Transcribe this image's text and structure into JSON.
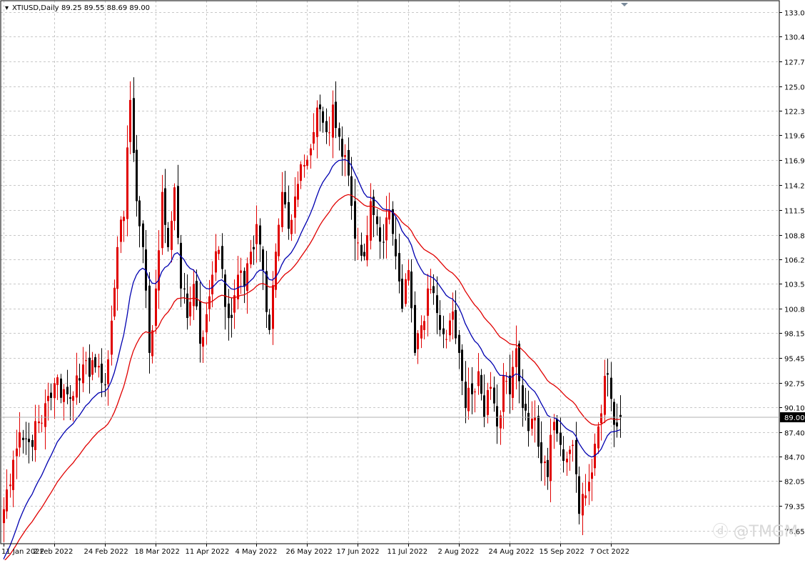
{
  "header": {
    "symbol": "XTIUSD,Daily",
    "ohlc": "89.25 89.55 88.69 89.00"
  },
  "watermark": "@TMGM",
  "chart_data": {
    "type": "candlestick",
    "symbol": "XTIUSD",
    "timeframe": "Daily",
    "ylim": [
      76.0,
      133.5
    ],
    "y_ticks": [
      "133.05",
      "130.40",
      "127.70",
      "125.00",
      "122.35",
      "119.65",
      "116.95",
      "114.25",
      "111.55",
      "108.85",
      "106.20",
      "103.50",
      "100.80",
      "98.15",
      "95.45",
      "92.75",
      "90.10",
      "87.40",
      "84.70",
      "82.05",
      "79.35",
      "76.65"
    ],
    "x_ticks": [
      {
        "label": "11 Jan 2022",
        "bar": 0
      },
      {
        "label": "2 Feb 2022",
        "bar": 16
      },
      {
        "label": "24 Feb 2022",
        "bar": 32
      },
      {
        "label": "18 Mar 2022",
        "bar": 48
      },
      {
        "label": "11 Apr 2022",
        "bar": 64
      },
      {
        "label": "4 May 2022",
        "bar": 80
      },
      {
        "label": "26 May 2022",
        "bar": 96
      },
      {
        "label": "17 Jun 2022",
        "bar": 112
      },
      {
        "label": "11 Jul 2022",
        "bar": 128
      },
      {
        "label": "2 Aug 2022",
        "bar": 144
      },
      {
        "label": "24 Aug 2022",
        "bar": 160
      },
      {
        "label": "15 Sep 2022",
        "bar": 176
      },
      {
        "label": "7 Oct 2022",
        "bar": 192
      }
    ],
    "current_price": "89.00",
    "colors": {
      "bull": "#e00000",
      "bear": "#000000",
      "ma_fast": "#0000b0",
      "ma_slow": "#e00000",
      "grid": "#c8c8c8",
      "price_tag_bg": "#000000",
      "price_tag_fg": "#ffffff"
    },
    "grid": true,
    "ma_fast_period": 20,
    "ma_slow_period": 40,
    "close_anchors": [
      [
        0,
        79.0
      ],
      [
        4,
        85.6
      ],
      [
        8,
        86.3
      ],
      [
        12,
        88.4
      ],
      [
        16,
        92.7
      ],
      [
        20,
        91.5
      ],
      [
        24,
        93.0
      ],
      [
        28,
        95.2
      ],
      [
        32,
        92.5
      ],
      [
        34,
        99.5
      ],
      [
        36,
        107.5
      ],
      [
        38,
        110.8
      ],
      [
        40,
        123.5
      ],
      [
        42,
        112.5
      ],
      [
        44,
        107.5
      ],
      [
        46,
        96.0
      ],
      [
        48,
        103.0
      ],
      [
        50,
        113.5
      ],
      [
        52,
        107.5
      ],
      [
        54,
        114.0
      ],
      [
        56,
        103.0
      ],
      [
        58,
        99.8
      ],
      [
        60,
        103.5
      ],
      [
        62,
        97.0
      ],
      [
        64,
        100.2
      ],
      [
        66,
        104.5
      ],
      [
        68,
        107.2
      ],
      [
        70,
        101.0
      ],
      [
        72,
        99.8
      ],
      [
        74,
        104.5
      ],
      [
        76,
        103.2
      ],
      [
        78,
        107.0
      ],
      [
        80,
        110.0
      ],
      [
        82,
        105.0
      ],
      [
        84,
        98.5
      ],
      [
        86,
        107.0
      ],
      [
        88,
        113.5
      ],
      [
        90,
        109.5
      ],
      [
        92,
        113.0
      ],
      [
        94,
        116.5
      ],
      [
        96,
        117.0
      ],
      [
        98,
        120.0
      ],
      [
        100,
        122.5
      ],
      [
        102,
        120.0
      ],
      [
        104,
        123.0
      ],
      [
        106,
        119.5
      ],
      [
        108,
        117.5
      ],
      [
        110,
        112.0
      ],
      [
        112,
        108.0
      ],
      [
        114,
        106.5
      ],
      [
        116,
        112.5
      ],
      [
        118,
        110.0
      ],
      [
        120,
        108.0
      ],
      [
        122,
        111.5
      ],
      [
        124,
        106.5
      ],
      [
        126,
        100.8
      ],
      [
        128,
        105.0
      ],
      [
        130,
        96.0
      ],
      [
        132,
        99.0
      ],
      [
        134,
        103.0
      ],
      [
        136,
        102.5
      ],
      [
        138,
        98.5
      ],
      [
        140,
        97.5
      ],
      [
        142,
        100.5
      ],
      [
        144,
        96.0
      ],
      [
        146,
        90.0
      ],
      [
        148,
        91.5
      ],
      [
        150,
        94.0
      ],
      [
        152,
        89.0
      ],
      [
        154,
        92.3
      ],
      [
        156,
        88.0
      ],
      [
        158,
        93.5
      ],
      [
        160,
        91.5
      ],
      [
        162,
        96.5
      ],
      [
        164,
        90.0
      ],
      [
        166,
        87.5
      ],
      [
        168,
        89.0
      ],
      [
        170,
        84.0
      ],
      [
        172,
        82.5
      ],
      [
        174,
        88.5
      ],
      [
        176,
        86.0
      ],
      [
        178,
        84.5
      ],
      [
        180,
        86.0
      ],
      [
        182,
        78.5
      ],
      [
        184,
        80.5
      ],
      [
        186,
        83.0
      ],
      [
        188,
        88.0
      ],
      [
        190,
        93.5
      ],
      [
        192,
        91.0
      ],
      [
        194,
        88.0
      ],
      [
        195,
        89.0
      ]
    ]
  }
}
